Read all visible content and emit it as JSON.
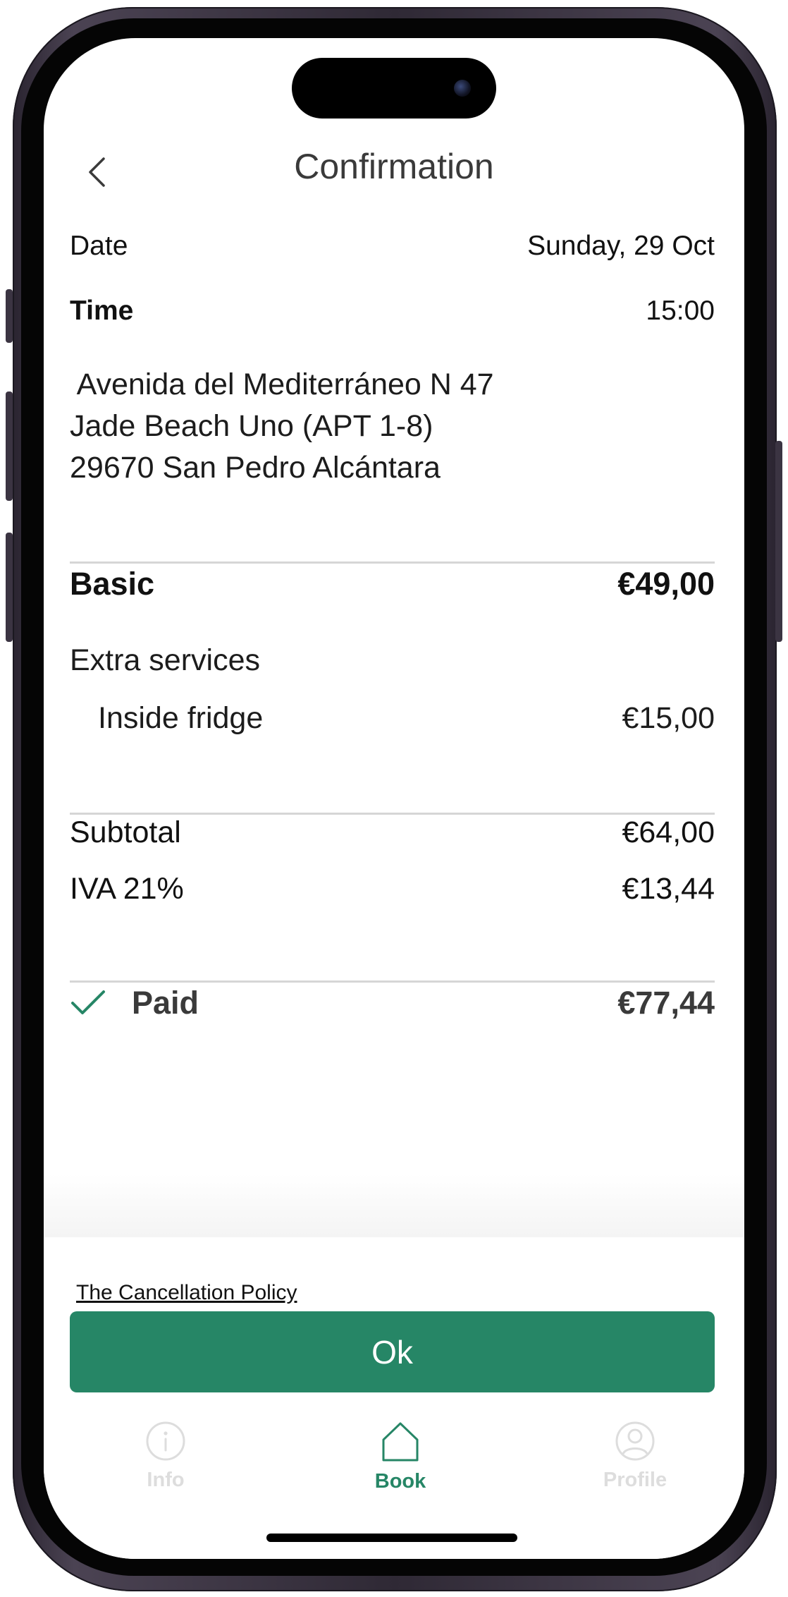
{
  "header": {
    "title": "Confirmation",
    "back_icon": "chevron-left-icon"
  },
  "booking": {
    "date_label": "Date",
    "date_value": "Sunday, 29 Oct",
    "time_label": "Time",
    "time_value": "15:00",
    "address": " Avenida del Mediterráneo N 47\nJade Beach Uno (APT 1-8)\n29670 San Pedro Alcántara"
  },
  "pricing": {
    "basic_label": "Basic",
    "basic_value": "€49,00",
    "extra_title": "Extra services",
    "extras": [
      {
        "label": "Inside fridge",
        "value": "€15,00"
      }
    ],
    "subtotal_label": "Subtotal",
    "subtotal_value": "€64,00",
    "iva_label": "IVA 21%",
    "iva_value": "€13,44",
    "paid_label": "Paid",
    "paid_value": "€77,44",
    "paid_icon": "checkmark-icon"
  },
  "footer": {
    "policy_link": "The Cancellation Policy",
    "ok_label": "Ok"
  },
  "tabbar": {
    "items": [
      {
        "label": "Info",
        "icon": "info-icon",
        "active": false
      },
      {
        "label": "Book",
        "icon": "home-icon",
        "active": true
      },
      {
        "label": "Profile",
        "icon": "profile-icon",
        "active": false
      }
    ]
  },
  "colors": {
    "accent": "#268666",
    "inactive_tab": "#dddddd",
    "text": "#111111",
    "divider": "#d6d6d6"
  }
}
